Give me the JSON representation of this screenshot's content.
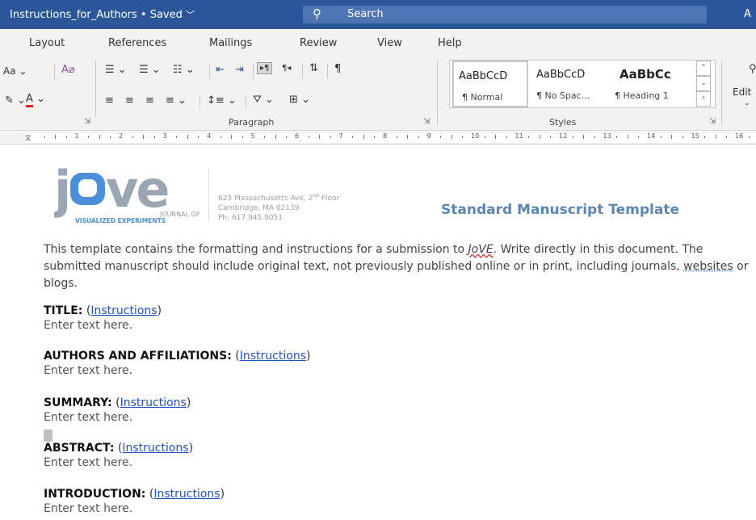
{
  "titlebar": {
    "doc_title": "Instructions_for_Authors • Saved",
    "chevron": "﹀",
    "search_placeholder": "Search",
    "right_text": "A"
  },
  "tabs": [
    "Layout",
    "References",
    "Mailings",
    "Review",
    "View",
    "Help"
  ],
  "ribbon": {
    "font_case": "Aa",
    "paragraph_label": "Paragraph",
    "styles_label": "Styles",
    "editing_label": "Edit",
    "styles": [
      {
        "preview": "AaBbCcD",
        "name": "¶ Normal"
      },
      {
        "preview": "AaBbCcD",
        "name": "¶ No Spac..."
      },
      {
        "preview": "AaBbCc",
        "name": "¶ Heading 1"
      }
    ]
  },
  "ruler": {
    "numbers": [
      "1",
      "2",
      "3",
      "4",
      "5",
      "6",
      "7",
      "8",
      "9",
      "10",
      "11",
      "12",
      "13",
      "14",
      "15",
      "16"
    ]
  },
  "document": {
    "logo_text": "jove",
    "logo_sub1": "JOURNAL OF",
    "logo_sub2": "VISUALIZED EXPERIMENTS",
    "address_line1": "625 Massachusetts Ave, 2",
    "address_sup": "nd",
    "address_line1_end": " Floor",
    "address_line2": "Cambridge, MA 02139",
    "address_line3": "Ph: 617.945.9051",
    "template_title": "Standard Manuscript Template",
    "intro_before": "This template contains the formatting and instructions for a submission to ",
    "intro_jove": "JoVE",
    "intro_after1": ". Write directly in this document. The submitted manuscript should include original text, not previously published online or in print, including journals, ",
    "intro_websites": "websites",
    "intro_after2": " or blogs.",
    "sections": [
      {
        "heading": "TITLE:",
        "link": "Instructions",
        "entry": "Enter text here."
      },
      {
        "heading": "AUTHORS AND AFFILIATIONS:",
        "link": "Instructions",
        "entry": "Enter text here."
      },
      {
        "heading": "SUMMARY:",
        "link": "Instructions",
        "entry": "Enter text here."
      },
      {
        "heading": "ABSTRACT:",
        "link": "Instructions",
        "entry": "Enter text here."
      },
      {
        "heading": "INTRODUCTION:",
        "link": "Instructions",
        "entry": "Enter text here."
      }
    ]
  }
}
